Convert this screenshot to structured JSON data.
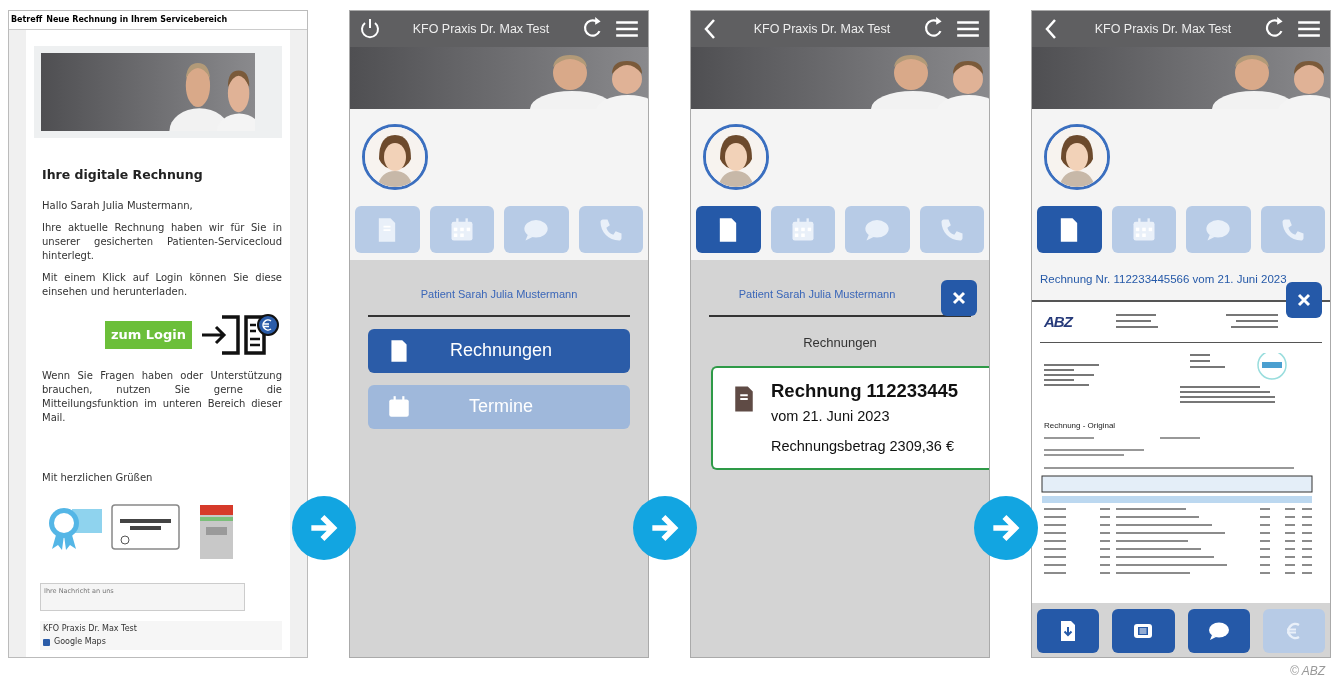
{
  "email": {
    "subject_label": "Betreff",
    "subject": "Neue Rechnung in Ihrem Servicebereich",
    "heading": "Ihre digitale Rechnung",
    "greeting": "Hallo Sarah Julia Mustermann,",
    "paragraphs": [
      "Ihre aktuelle Rechnung haben wir für Sie in unserer gesicherten Patienten-Servicecloud hinterlegt.",
      "Mit einem Klick auf Login können Sie diese einsehen und herunterladen."
    ],
    "login_button": "zum Login",
    "paragraph_after": "Wenn Sie Fragen haben oder Unterstützung brauchen, nutzen Sie gerne die Mitteilungsfunktion im unteren Bereich dieser Mail.",
    "closing": "Mit herzlichen Grüßen",
    "message_placeholder": "Ihre Nachricht an uns",
    "footer": {
      "practice": "KFO Praxis Dr. Max Test",
      "maps": "Google Maps"
    }
  },
  "screens": [
    {
      "title": "KFO Praxis Dr. Max Test",
      "left_button": {
        "kind": "power"
      },
      "tabs": [
        {
          "kind": "invoice",
          "selected": false
        },
        {
          "kind": "calendar",
          "selected": false
        },
        {
          "kind": "chat",
          "selected": false
        },
        {
          "kind": "phone",
          "selected": false
        }
      ],
      "content": {
        "kind": "menu",
        "patient": "Patient Sarah Julia Mustermann",
        "buttons": [
          {
            "label": "Rechnungen",
            "kind": "invoice",
            "disabled": false
          },
          {
            "label": "Termine",
            "kind": "appointment",
            "disabled": true
          }
        ]
      }
    },
    {
      "title": "KFO Praxis Dr. Max Test",
      "left_button": {
        "kind": "back"
      },
      "tabs": [
        {
          "kind": "invoice",
          "selected": true
        },
        {
          "kind": "calendar",
          "selected": false
        },
        {
          "kind": "chat",
          "selected": false
        },
        {
          "kind": "phone",
          "selected": false
        }
      ],
      "content": {
        "kind": "list",
        "patient": "Patient Sarah Julia Mustermann",
        "section": "Rechnungen",
        "card": {
          "title": "Rechnung 112233445",
          "date": "vom 21. Juni 2023",
          "amount": "Rechnungsbetrag 2309,36 €"
        }
      }
    },
    {
      "title": "KFO Praxis Dr. Max Test",
      "left_button": {
        "kind": "back"
      },
      "tabs": [
        {
          "kind": "invoice",
          "selected": true
        },
        {
          "kind": "calendar",
          "selected": false
        },
        {
          "kind": "chat",
          "selected": false
        },
        {
          "kind": "phone",
          "selected": false
        }
      ],
      "content": {
        "kind": "document",
        "heading": "Rechnung Nr. 112233445566 vom 21. Juni 2023",
        "doc": {
          "logo": "ABZ",
          "title": "Rechnung - Original"
        },
        "toolbar": [
          {
            "kind": "download",
            "disabled": false
          },
          {
            "kind": "print",
            "disabled": false
          },
          {
            "kind": "chat",
            "disabled": false
          },
          {
            "kind": "euro",
            "disabled": true
          }
        ]
      }
    }
  ],
  "credit": "© ABZ"
}
